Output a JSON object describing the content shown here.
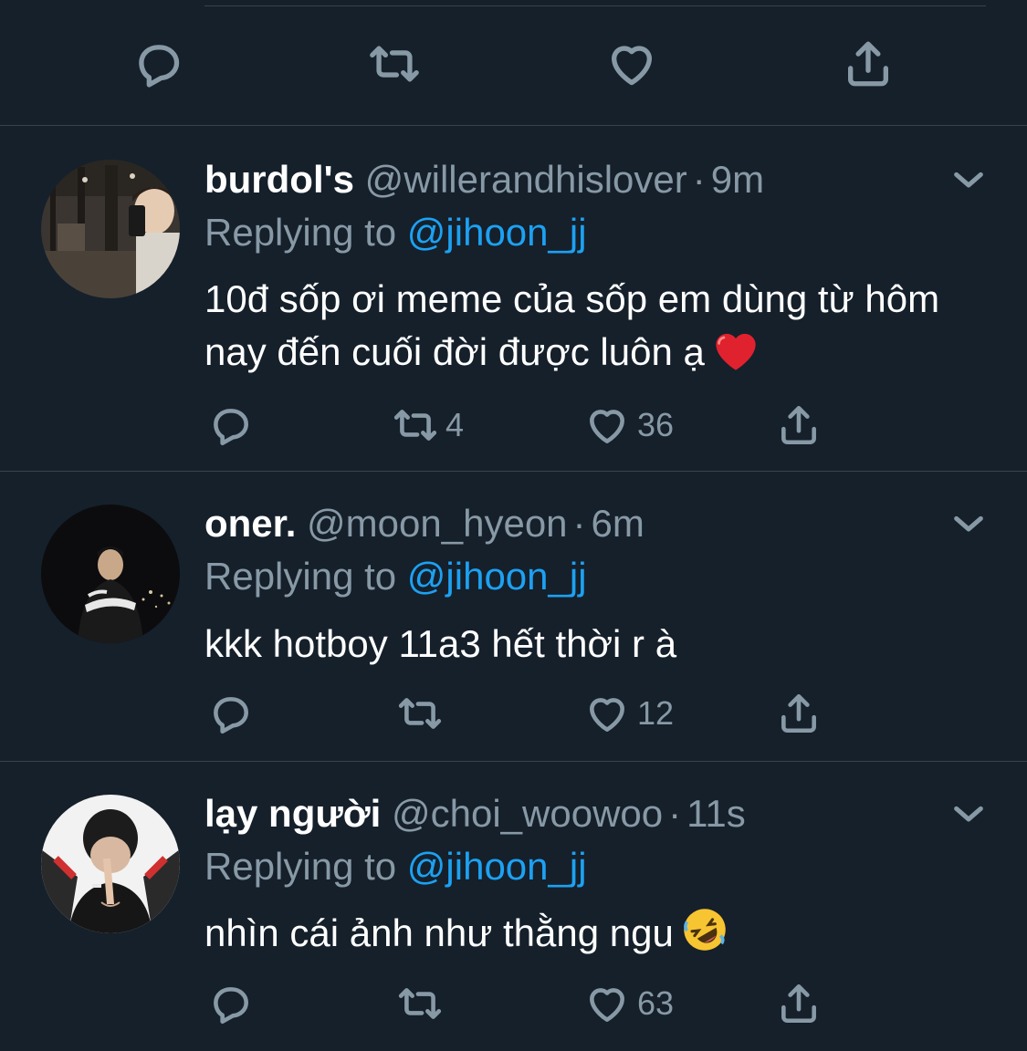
{
  "top_actions": {
    "icons": [
      "reply-icon",
      "retweet-icon",
      "like-icon",
      "share-icon"
    ]
  },
  "colors": {
    "background": "#15202b",
    "muted": "#8899a6",
    "accent": "#1da1f2",
    "divider": "#38444d"
  },
  "tweets": [
    {
      "display_name": "burdol's",
      "handle": "@willerandhislover",
      "separator": "·",
      "time": "9m",
      "replying_prefix": "Replying to",
      "replying_to": "@jihoon_jj",
      "text": "10đ sốp ơi meme của sốp em dùng từ hôm nay đến cuối đời được luôn ạ",
      "emoji": "red-heart-emoji",
      "retweets": "4",
      "likes": "36"
    },
    {
      "display_name": "oner.",
      "handle": "@moon_hyeon",
      "separator": "·",
      "time": "6m",
      "replying_prefix": "Replying to",
      "replying_to": "@jihoon_jj",
      "text": "kkk hotboy 11a3 hết thời r à",
      "retweets": "",
      "likes": "12"
    },
    {
      "display_name": "lạy người",
      "handle": "@choi_woowoo",
      "separator": "·",
      "time": "11s",
      "replying_prefix": "Replying to",
      "replying_to": "@jihoon_jj",
      "text": "nhìn cái ảnh như thằng ngu",
      "emoji": "rolling-laughing-emoji",
      "retweets": "",
      "likes": "63"
    }
  ]
}
